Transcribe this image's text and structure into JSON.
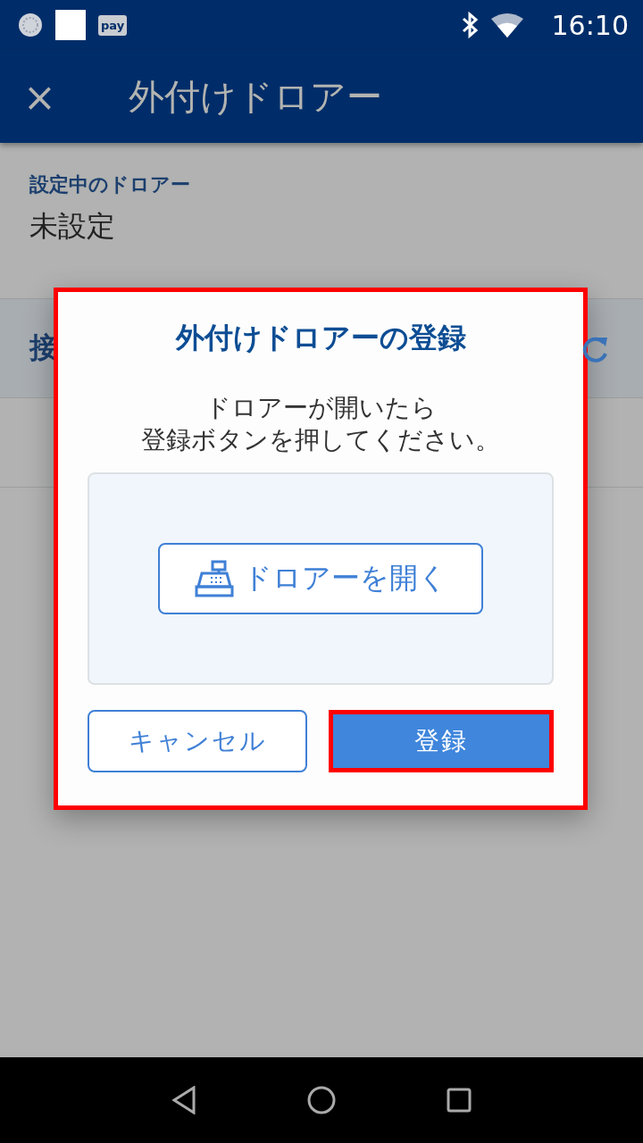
{
  "status_bar": {
    "time": "16:10",
    "notification_badge": "pay"
  },
  "app_bar": {
    "close": "×",
    "title": "外付けドロアー"
  },
  "current_drawer": {
    "label": "設定中のドロアー",
    "value": "未設定"
  },
  "section_header": {
    "label": "接"
  },
  "dialog": {
    "title": "外付けドロアーの登録",
    "message_lines": [
      "ドロアーが開いたら",
      "登録ボタンを押してください。"
    ],
    "open_button": "ドロアーを開く",
    "highlighted": true,
    "buttons": [
      {
        "label": "キャンセル",
        "kind": "secondary",
        "highlighted": false
      },
      {
        "label": "登録",
        "kind": "primary",
        "highlighted": true
      }
    ]
  }
}
